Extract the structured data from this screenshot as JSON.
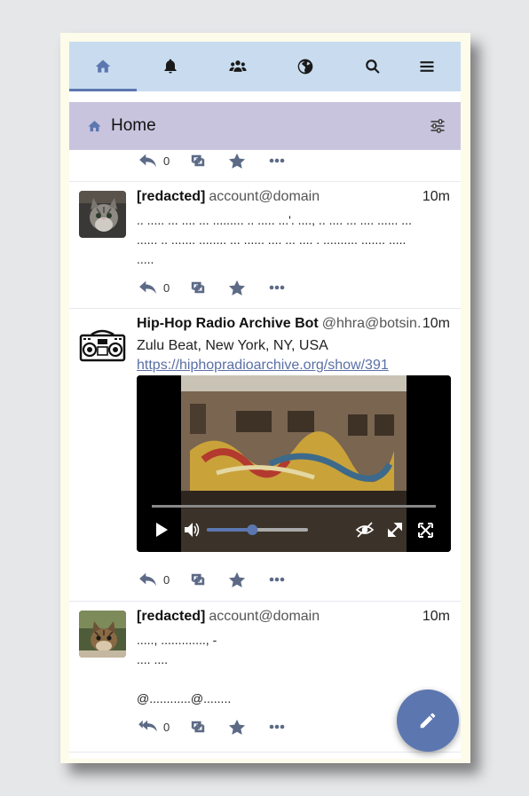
{
  "nav": {
    "items": [
      {
        "icon": "home-icon"
      },
      {
        "icon": "bell-icon"
      },
      {
        "icon": "users-icon"
      },
      {
        "icon": "globe-icon"
      },
      {
        "icon": "search-icon"
      },
      {
        "icon": "menu-icon"
      }
    ],
    "accent": "#5c77b0",
    "background": "#c9dcef"
  },
  "header": {
    "title": "Home",
    "icon": "home-icon",
    "settings_icon": "sliders-icon",
    "background": "#c9c4de"
  },
  "statuses": [
    {
      "partial": true,
      "reply_count": "0"
    },
    {
      "name": "[redacted]",
      "acct": "account@domain",
      "time": "10m",
      "lines": [
        ".. ..... ... .... ... ......... .. ..... ...'. ...., .. .... ... .... ...... ...",
        "...... .. ....... ........ ... ...... .... ... .... . .......... ....... .....",
        "....."
      ],
      "reply_count": "0"
    },
    {
      "name": "Hip-Hop Radio Archive Bot",
      "acct": "@hhra@botsin.…",
      "time": "10m",
      "text": "Zulu Beat, New York, NY, USA",
      "link": "https://hiphopradioarchive.org/show/391",
      "media": "video",
      "volume": 0.45,
      "reply_count": "0"
    },
    {
      "name": "[redacted]",
      "acct": "account@domain",
      "time": "10m",
      "lines": [
        ".....,  ............., -",
        ".... ....",
        "",
        "@............@........"
      ],
      "reply_count": "0"
    }
  ],
  "compose_icon": "pencil-icon"
}
